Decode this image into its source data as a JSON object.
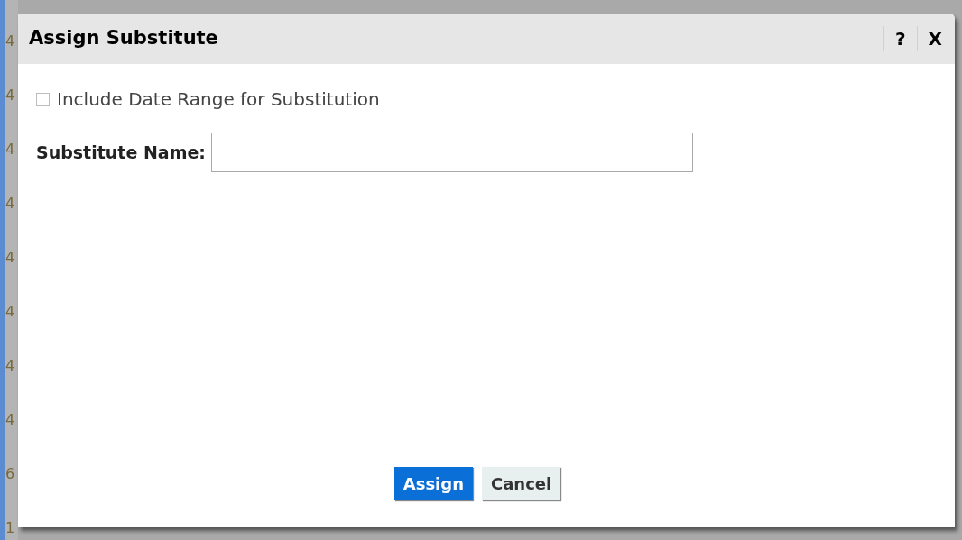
{
  "background_cells": [
    "4",
    "4",
    "4",
    "4",
    "4",
    "4",
    "4",
    "4",
    "6",
    "1"
  ],
  "dialog": {
    "title": "Assign Substitute",
    "help": "?",
    "close": "X",
    "checkbox": {
      "label": "Include Date Range for Substitution",
      "checked": false
    },
    "field": {
      "label": "Substitute Name:"
    },
    "buttons": [
      {
        "label": "Assign",
        "kind": "primary"
      },
      {
        "label": "Cancel",
        "kind": "secondary"
      }
    ]
  }
}
